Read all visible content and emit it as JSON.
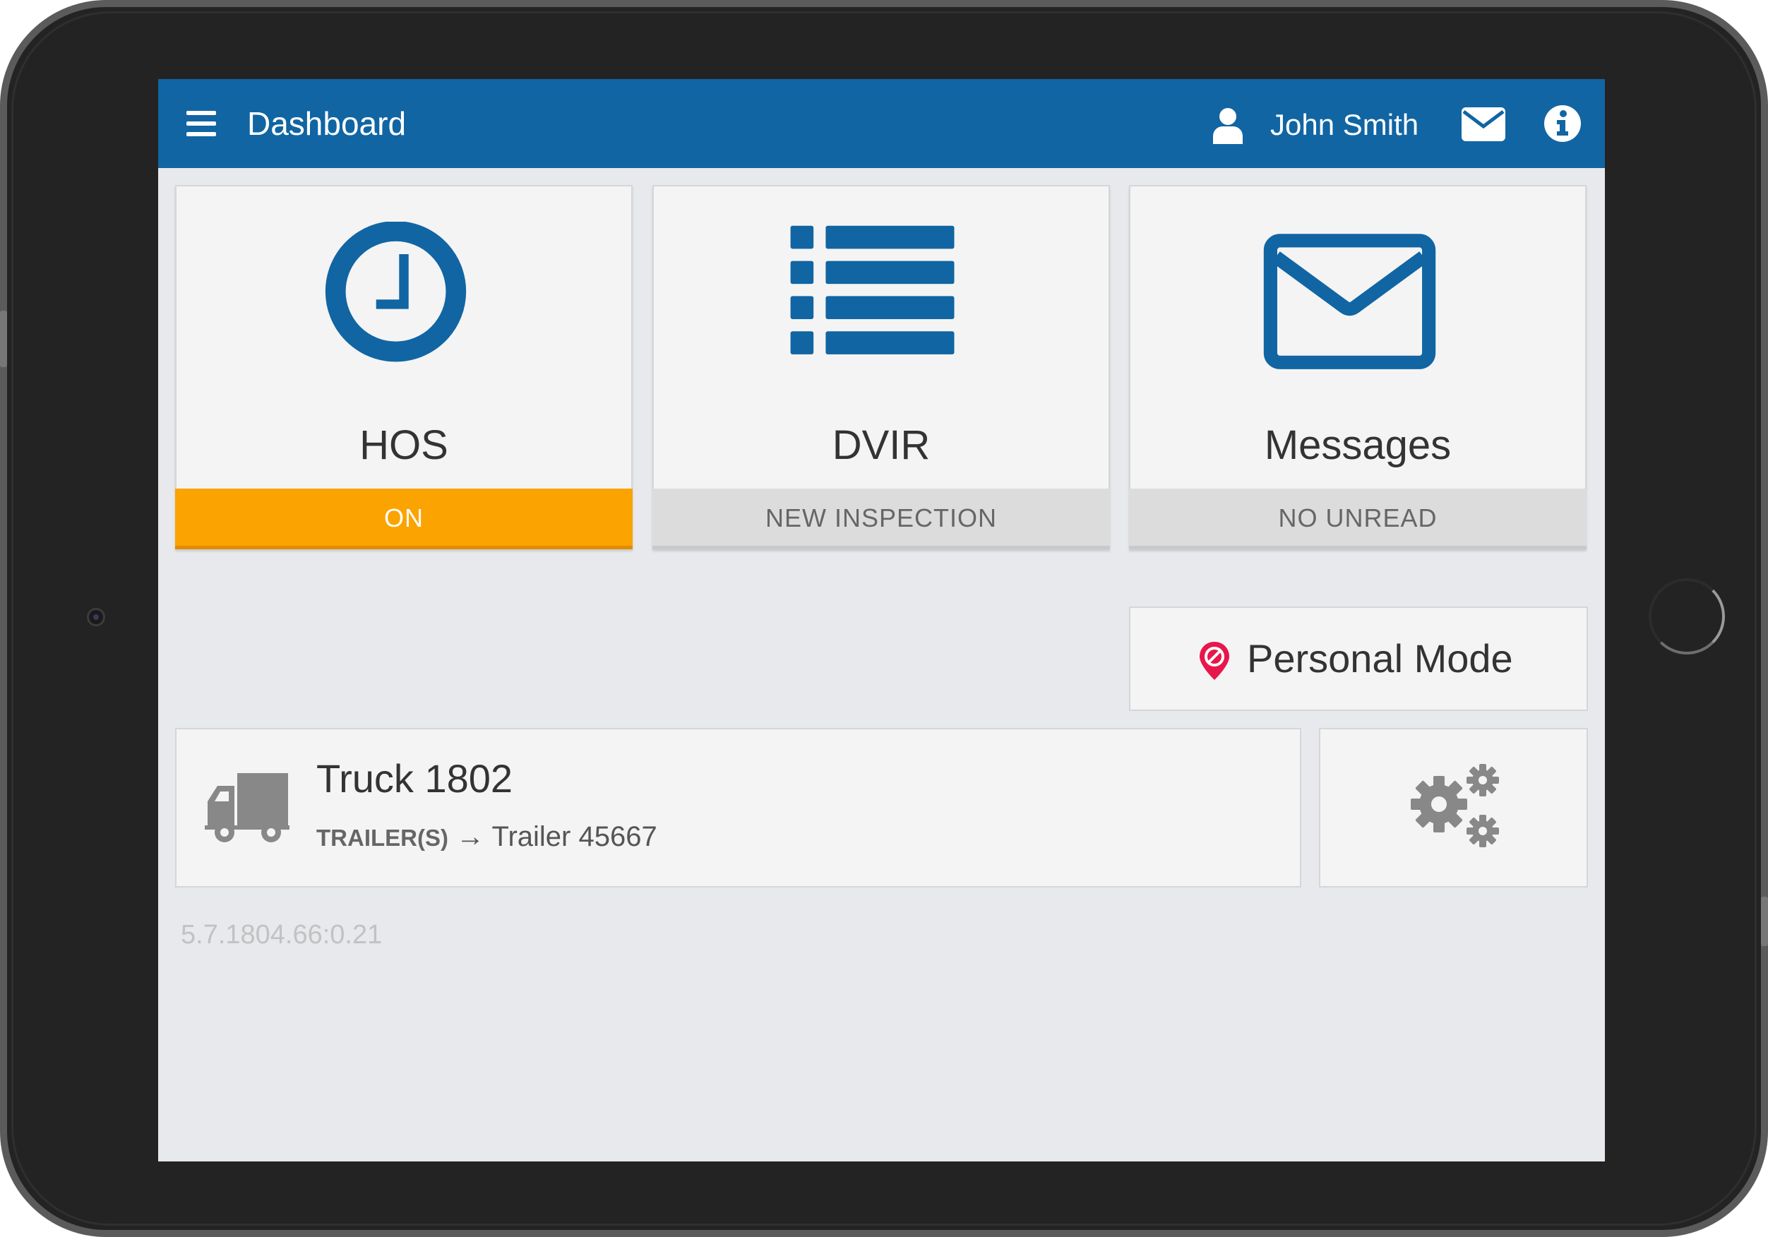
{
  "header": {
    "title": "Dashboard",
    "user_name": "John Smith",
    "bar_color": "#1165a3",
    "icons": [
      "menu-icon",
      "user-icon",
      "mail-icon",
      "info-icon"
    ]
  },
  "tiles": [
    {
      "label": "HOS",
      "status": "ON",
      "icon": "clock-icon",
      "status_color": "#fba301"
    },
    {
      "label": "DVIR",
      "status": "NEW INSPECTION",
      "icon": "list-icon"
    },
    {
      "label": "Messages",
      "status": "NO UNREAD",
      "icon": "envelope-icon"
    }
  ],
  "personal_mode": {
    "label": "Personal Mode",
    "icon": "location-blocked-icon"
  },
  "vehicle": {
    "truck": "Truck 1802",
    "trailer_label": "TRAILER(S)",
    "trailer_arrow": "→",
    "trailer_value": "Trailer 45667",
    "icon": "truck-icon"
  },
  "settings": {
    "icon": "gears-icon"
  },
  "version": "5.7.1804.66:0.21",
  "colors": {
    "accent": "#1165a3",
    "warning": "#fba301",
    "alert_pin": "#e8174b",
    "background": "#e8e9ed"
  }
}
